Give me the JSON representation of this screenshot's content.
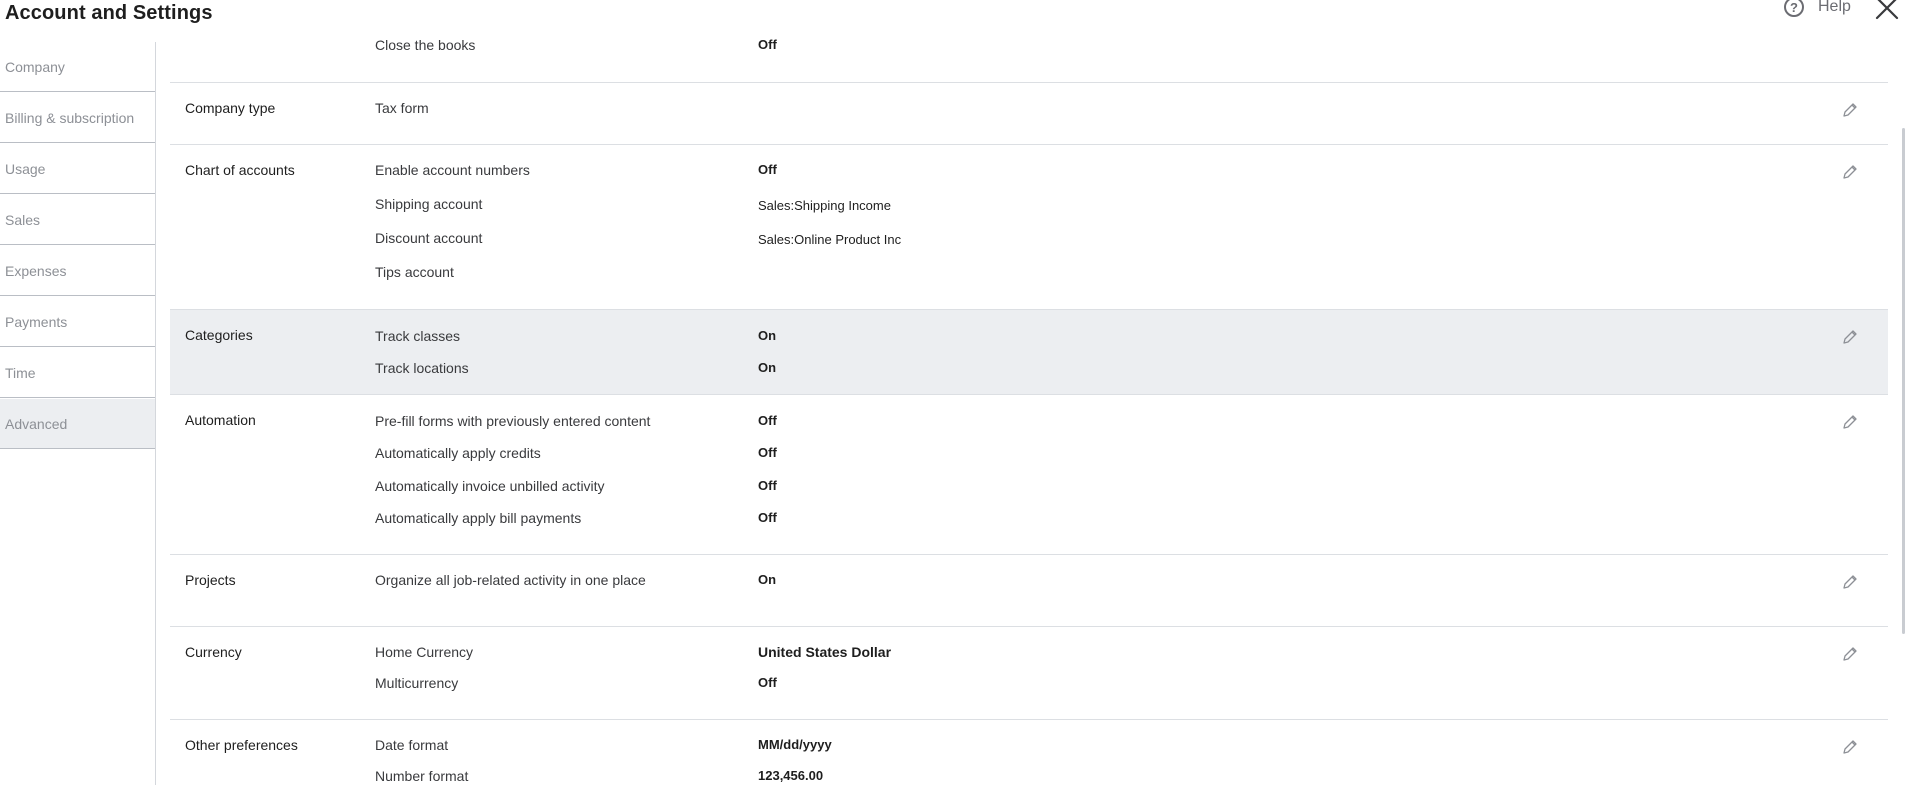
{
  "header": {
    "title": "Account and Settings",
    "help_label": "Help",
    "help_glyph": "?"
  },
  "sidebar": {
    "items": [
      {
        "label": "Company"
      },
      {
        "label": "Billing & subscription"
      },
      {
        "label": "Usage"
      },
      {
        "label": "Sales"
      },
      {
        "label": "Expenses"
      },
      {
        "label": "Payments"
      },
      {
        "label": "Time"
      },
      {
        "label": "Advanced",
        "active": true
      }
    ]
  },
  "sections": {
    "accounting": {
      "items": [
        {
          "label": "Close the books",
          "value": "Off"
        }
      ]
    },
    "company_type": {
      "label": "Company type",
      "items": [
        {
          "label": "Tax form",
          "value": ""
        }
      ]
    },
    "chart_of_accounts": {
      "label": "Chart of accounts",
      "items": [
        {
          "label": "Enable account numbers",
          "value": "Off"
        },
        {
          "label": "Shipping account",
          "value": "Sales:Shipping Income"
        },
        {
          "label": "Discount account",
          "value": "Sales:Online Product Inc"
        },
        {
          "label": "Tips account",
          "value": ""
        }
      ]
    },
    "categories": {
      "label": "Categories",
      "items": [
        {
          "label": "Track classes",
          "value": "On"
        },
        {
          "label": "Track locations",
          "value": "On"
        }
      ]
    },
    "automation": {
      "label": "Automation",
      "items": [
        {
          "label": "Pre-fill forms with previously entered content",
          "value": "Off"
        },
        {
          "label": "Automatically apply credits",
          "value": "Off"
        },
        {
          "label": "Automatically invoice unbilled activity",
          "value": "Off"
        },
        {
          "label": "Automatically apply bill payments",
          "value": "Off"
        }
      ]
    },
    "projects": {
      "label": "Projects",
      "items": [
        {
          "label": "Organize all job-related activity in one place",
          "value": "On"
        }
      ]
    },
    "currency": {
      "label": "Currency",
      "items": [
        {
          "label": "Home Currency",
          "value": "United States Dollar"
        },
        {
          "label": "Multicurrency",
          "value": "Off"
        }
      ]
    },
    "other_preferences": {
      "label": "Other preferences",
      "items": [
        {
          "label": "Date format",
          "value": "MM/dd/yyyy"
        },
        {
          "label": "Number format",
          "value": "123,456.00"
        }
      ]
    }
  },
  "icons": {
    "help": "help-circle-icon",
    "close": "close-icon",
    "edit": "pencil-icon"
  },
  "colors": {
    "highlight_row": "#eceef1",
    "active_nav": "#eceef1",
    "divider": "#dcdfe3",
    "muted_text": "#8d9096"
  }
}
